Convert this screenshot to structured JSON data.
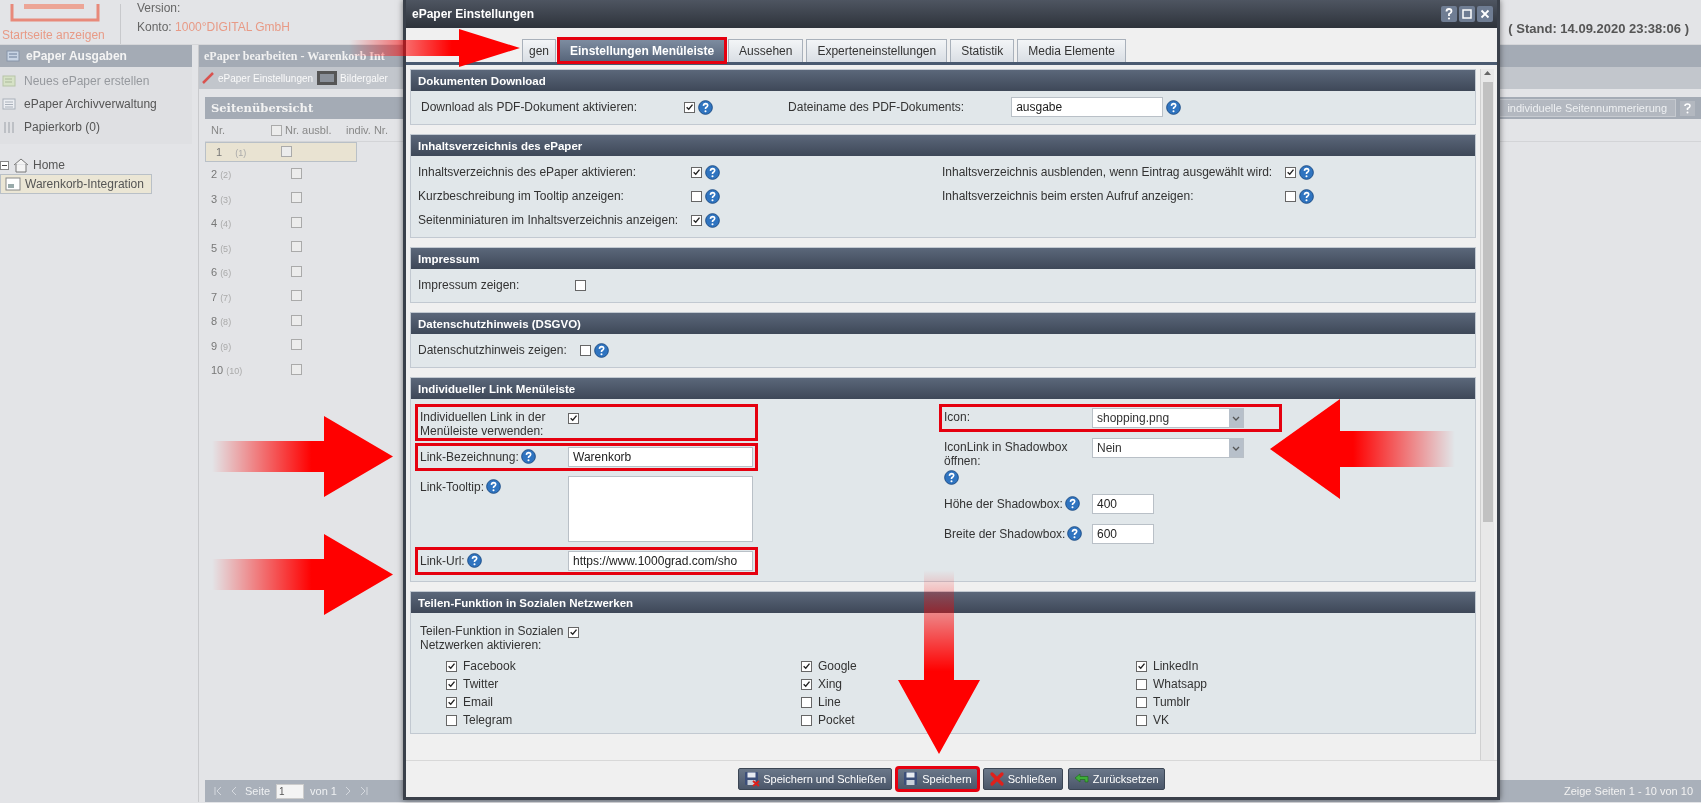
{
  "header": {
    "home_link": "Startseite anzeigen",
    "version_label": "Version:",
    "account_label": "Konto:",
    "account": "1000°DIGITAL GmbH",
    "status": "( Stand: 14.09.2020 23:38:06 )"
  },
  "sidebar": {
    "title": "ePaper Ausgaben",
    "items": [
      {
        "label": "Neues ePaper erstellen",
        "disabled": true
      },
      {
        "label": "ePaper Archivverwaltung",
        "disabled": false
      },
      {
        "label": "Papierkorb (0)",
        "disabled": false
      }
    ],
    "tree": [
      {
        "label": "Home",
        "expanded": true,
        "selected": false,
        "children": [
          {
            "label": "Warenkorb-Integration",
            "selected": true
          }
        ]
      }
    ]
  },
  "editor": {
    "title": "ePaper bearbeiten - Warenkorb Int",
    "toolbar": [
      "ePaper Einstellungen",
      "Bildergaler"
    ],
    "grid": {
      "title": "Seitenübersicht",
      "numbering_button": "individuelle Seitennummerierung",
      "columns": [
        "Nr.",
        "Nr. ausbl.",
        "indiv. Nr."
      ],
      "header_checked": false,
      "rows": [
        {
          "nr": "1",
          "orig": "(1)",
          "hidden": false,
          "selected": true
        },
        {
          "nr": "2",
          "orig": "(2)",
          "hidden": false,
          "selected": false
        },
        {
          "nr": "3",
          "orig": "(3)",
          "hidden": false,
          "selected": false
        },
        {
          "nr": "4",
          "orig": "(4)",
          "hidden": false,
          "selected": false
        },
        {
          "nr": "5",
          "orig": "(5)",
          "hidden": false,
          "selected": false
        },
        {
          "nr": "6",
          "orig": "(6)",
          "hidden": false,
          "selected": false
        },
        {
          "nr": "7",
          "orig": "(7)",
          "hidden": false,
          "selected": false
        },
        {
          "nr": "8",
          "orig": "(8)",
          "hidden": false,
          "selected": false
        },
        {
          "nr": "9",
          "orig": "(9)",
          "hidden": false,
          "selected": false
        },
        {
          "nr": "10",
          "orig": "(10)",
          "hidden": false,
          "selected": false
        }
      ]
    },
    "pager": {
      "page_label": "Seite",
      "page": "1",
      "of": "von 1",
      "summary": "Zeige Seiten 1 - 10 von 10"
    }
  },
  "dialog": {
    "title": "ePaper Einstellungen",
    "tabs": [
      {
        "label": "gen",
        "selected": false,
        "highlighted": false
      },
      {
        "label": "Einstellungen Menüleiste",
        "selected": true,
        "highlighted": true
      },
      {
        "label": "Aussehen",
        "selected": false,
        "highlighted": false
      },
      {
        "label": "Experteneinstellungen",
        "selected": false,
        "highlighted": false
      },
      {
        "label": "Statistik",
        "selected": false,
        "highlighted": false
      },
      {
        "label": "Media Elemente",
        "selected": false,
        "highlighted": false
      }
    ],
    "sections": [
      {
        "title": "Dokumenten Download",
        "kind": "inline",
        "left": [
          {
            "kind": "checkbox",
            "label": "Download als PDF-Dokument aktivieren:",
            "checked": true,
            "help": true,
            "highlighted": false
          }
        ],
        "right": [
          {
            "kind": "text",
            "label": "Dateiname des PDF-Dokuments:",
            "value": "ausgabe",
            "help": true,
            "highlighted": false
          }
        ]
      },
      {
        "title": "Inhaltsverzeichnis des ePaper",
        "kind": "columns",
        "left": [
          {
            "kind": "checkbox",
            "label": "Inhaltsverzeichnis des ePaper aktivieren:",
            "checked": true,
            "help": true,
            "highlighted": false
          },
          {
            "kind": "checkbox",
            "label": "Kurzbeschreibung im Tooltip anzeigen:",
            "checked": false,
            "help": true,
            "highlighted": false
          },
          {
            "kind": "checkbox",
            "label": "Seitenminiaturen im Inhaltsverzeichnis anzeigen:",
            "checked": true,
            "help": true,
            "highlighted": false
          }
        ],
        "right": [
          {
            "kind": "checkbox",
            "label": "Inhaltsverzeichnis ausblenden, wenn Eintrag ausgewählt wird:",
            "checked": true,
            "help": true,
            "highlighted": false
          },
          {
            "kind": "checkbox",
            "label": "Inhaltsverzeichnis beim ersten Aufruf anzeigen:",
            "checked": false,
            "help": true,
            "highlighted": false
          }
        ]
      },
      {
        "title": "Impressum",
        "kind": "columns",
        "left": [
          {
            "kind": "checkbox",
            "label": "Impressum zeigen:",
            "checked": false,
            "help": false,
            "highlighted": false
          }
        ]
      },
      {
        "title": "Datenschutzhinweis (DSGVO)",
        "kind": "columns",
        "left": [
          {
            "kind": "checkbox",
            "label": "Datenschutzhinweis zeigen:",
            "checked": false,
            "help": true,
            "highlighted": false
          }
        ]
      },
      {
        "title": "Individueller Link Menüleiste",
        "kind": "form",
        "left": [
          {
            "kind": "checkbox",
            "label": "Individuellen Link in der Menüleiste verwenden:",
            "checked": true,
            "help": false,
            "highlighted": true
          },
          {
            "kind": "text",
            "label": "Link-Bezeichnung:",
            "value": "Warenkorb",
            "help": true,
            "highlighted": true
          },
          {
            "kind": "textarea",
            "label": "Link-Tooltip:",
            "help": true,
            "highlighted": false
          },
          {
            "kind": "text",
            "label": "Link-Url:",
            "value": "https://www.1000grad.com/sho",
            "help": true,
            "highlighted": true
          }
        ],
        "right": [
          {
            "kind": "select",
            "label": "Icon:",
            "value": "shopping.png",
            "help": false,
            "highlighted": true
          },
          {
            "kind": "select",
            "label": "IconLink in Shadowbox öffnen:",
            "value": "Nein",
            "help": true,
            "highlighted": false
          },
          {
            "kind": "text",
            "label": "Höhe der Shadowbox:",
            "value": "400",
            "help": true,
            "highlighted": false
          },
          {
            "kind": "text",
            "label": "Breite der Shadowbox:",
            "value": "600",
            "help": true,
            "highlighted": false
          }
        ]
      },
      {
        "title": "Teilen-Funktion in Sozialen Netzwerken",
        "kind": "share",
        "left": [
          {
            "kind": "checkbox",
            "label": "Teilen-Funktion in Sozialen Netzwerken aktivieren:",
            "checked": true,
            "help": false,
            "highlighted": false
          }
        ],
        "options": [
          {
            "label": "Facebook",
            "checked": true
          },
          {
            "label": "Google",
            "checked": true
          },
          {
            "label": "LinkedIn",
            "checked": true
          },
          {
            "label": "Twitter",
            "checked": true
          },
          {
            "label": "Xing",
            "checked": true
          },
          {
            "label": "Whatsapp",
            "checked": false
          },
          {
            "label": "Email",
            "checked": true
          },
          {
            "label": "Line",
            "checked": false
          },
          {
            "label": "Tumblr",
            "checked": false
          },
          {
            "label": "Telegram",
            "checked": false
          },
          {
            "label": "Pocket",
            "checked": false
          },
          {
            "label": "VK",
            "checked": false
          }
        ]
      }
    ],
    "buttons": [
      {
        "label": "Speichern und Schließen",
        "kind": "save-close",
        "highlighted": false
      },
      {
        "label": "Speichern",
        "kind": "save",
        "highlighted": true
      },
      {
        "label": "Schließen",
        "kind": "close",
        "highlighted": false
      },
      {
        "label": "Zurücksetzen",
        "kind": "reset",
        "highlighted": false
      }
    ]
  }
}
